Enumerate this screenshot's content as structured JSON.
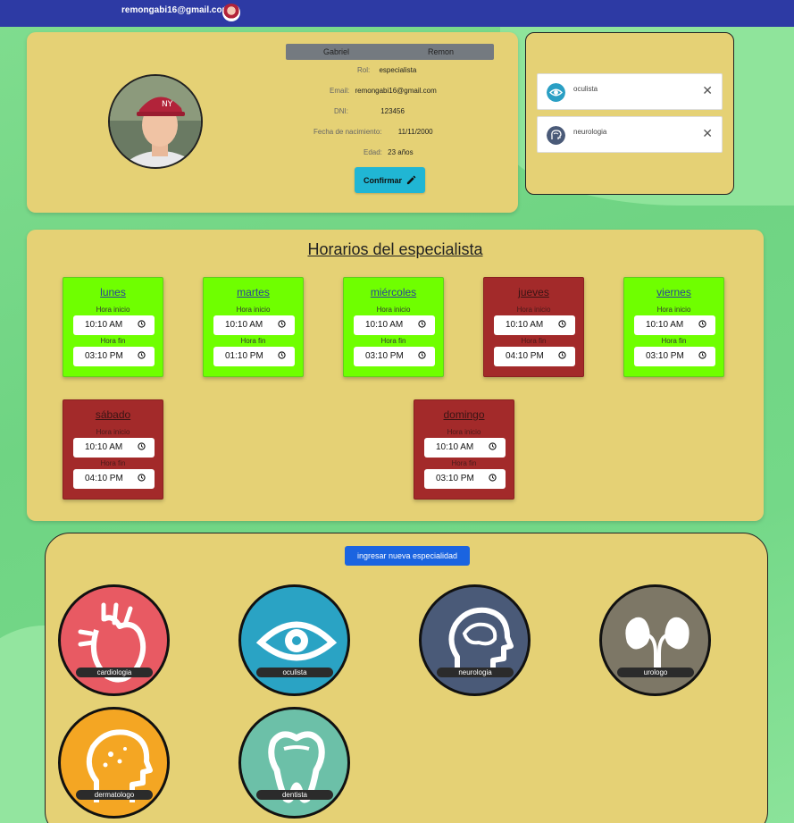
{
  "topbar": {
    "email": "remongabi16@gmail.com"
  },
  "profile": {
    "first_name": "Gabriel",
    "last_name": "Remon",
    "rol_label": "Rol:",
    "rol": "especialista",
    "email_label": "Email:",
    "email": "remongabi16@gmail.com",
    "dni_label": "DNI:",
    "dni": "123456",
    "birth_label": "Fecha de nacimiento:",
    "birth": "11/11/2000",
    "age_label": "Edad:",
    "age": "23 años",
    "confirm_label": "Confirmar"
  },
  "specialties": [
    {
      "name": "oculista",
      "icon": "eye-icon",
      "color": "#2a9fc4"
    },
    {
      "name": "neurologia",
      "icon": "brain-icon",
      "color": "#4a5a78"
    }
  ],
  "schedule": {
    "title": "Horarios del especialista",
    "start_label": "Hora inicio",
    "end_label": "Hora fin",
    "days": [
      {
        "name": "lunes",
        "active": true,
        "start": "10:10 AM",
        "end": "03:10 PM"
      },
      {
        "name": "martes",
        "active": true,
        "start": "10:10 AM",
        "end": "01:10 PM"
      },
      {
        "name": "miércoles",
        "active": true,
        "start": "10:10 AM",
        "end": "03:10 PM"
      },
      {
        "name": "jueves",
        "active": false,
        "start": "10:10 AM",
        "end": "04:10 PM"
      },
      {
        "name": "viernes",
        "active": true,
        "start": "10:10 AM",
        "end": "03:10 PM"
      },
      {
        "name": "sábado",
        "active": false,
        "start": "10:10 AM",
        "end": "04:10 PM"
      },
      {
        "name": "domingo",
        "active": false,
        "start": "10:10 AM",
        "end": "03:10 PM"
      }
    ]
  },
  "areas": {
    "add_label": "ingresar nueva especialidad",
    "items": [
      {
        "name": "cardiologia",
        "icon": "heart-icon",
        "color": "#e85a63"
      },
      {
        "name": "oculista",
        "icon": "eye-icon",
        "color": "#2aa3c4"
      },
      {
        "name": "neurologia",
        "icon": "brain-icon",
        "color": "#4a5a78"
      },
      {
        "name": "urologo",
        "icon": "kidney-icon",
        "color": "#7d7766"
      },
      {
        "name": "dermatologo",
        "icon": "skin-icon",
        "color": "#f4a623"
      },
      {
        "name": "dentista",
        "icon": "tooth-icon",
        "color": "#6cc0a8"
      }
    ]
  }
}
